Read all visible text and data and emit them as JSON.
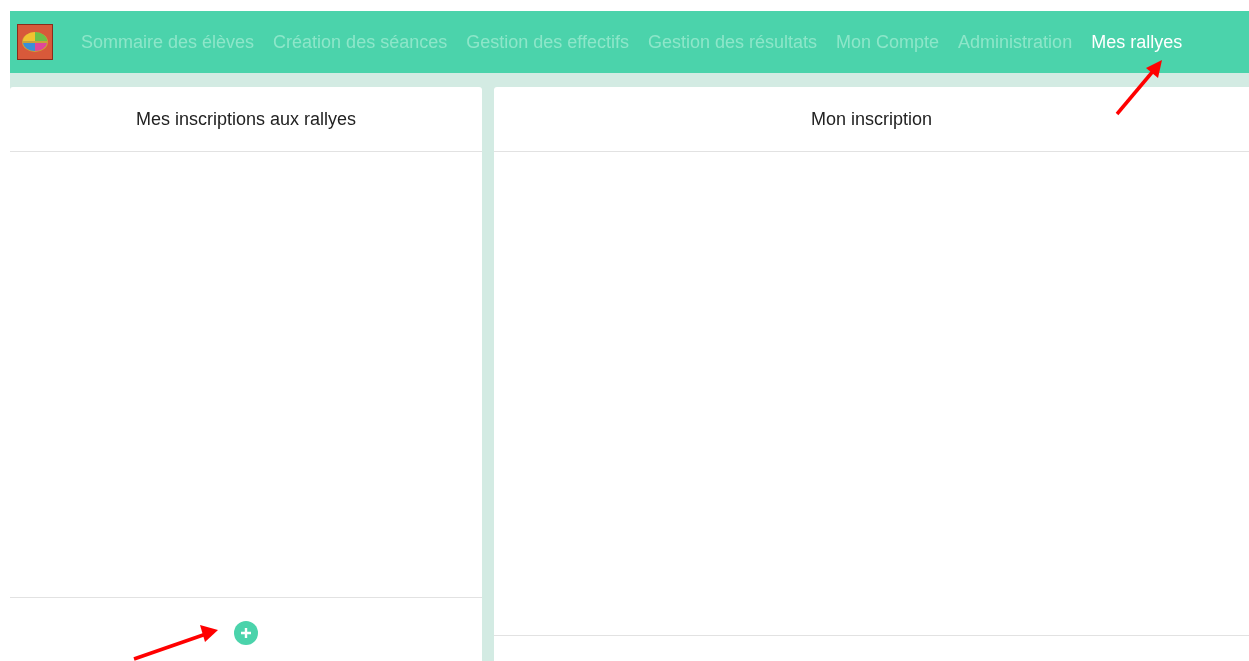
{
  "nav": {
    "items": [
      {
        "label": "Sommaire des élèves",
        "selected": false
      },
      {
        "label": "Création des séances",
        "selected": false
      },
      {
        "label": "Gestion des effectifs",
        "selected": false
      },
      {
        "label": "Gestion des résultats",
        "selected": false
      },
      {
        "label": "Mon Compte",
        "selected": false
      },
      {
        "label": "Administration",
        "selected": false
      },
      {
        "label": "Mes rallyes",
        "selected": true
      }
    ]
  },
  "left_panel": {
    "title": "Mes inscriptions aux rallyes"
  },
  "right_panel": {
    "title": "Mon inscription"
  }
}
